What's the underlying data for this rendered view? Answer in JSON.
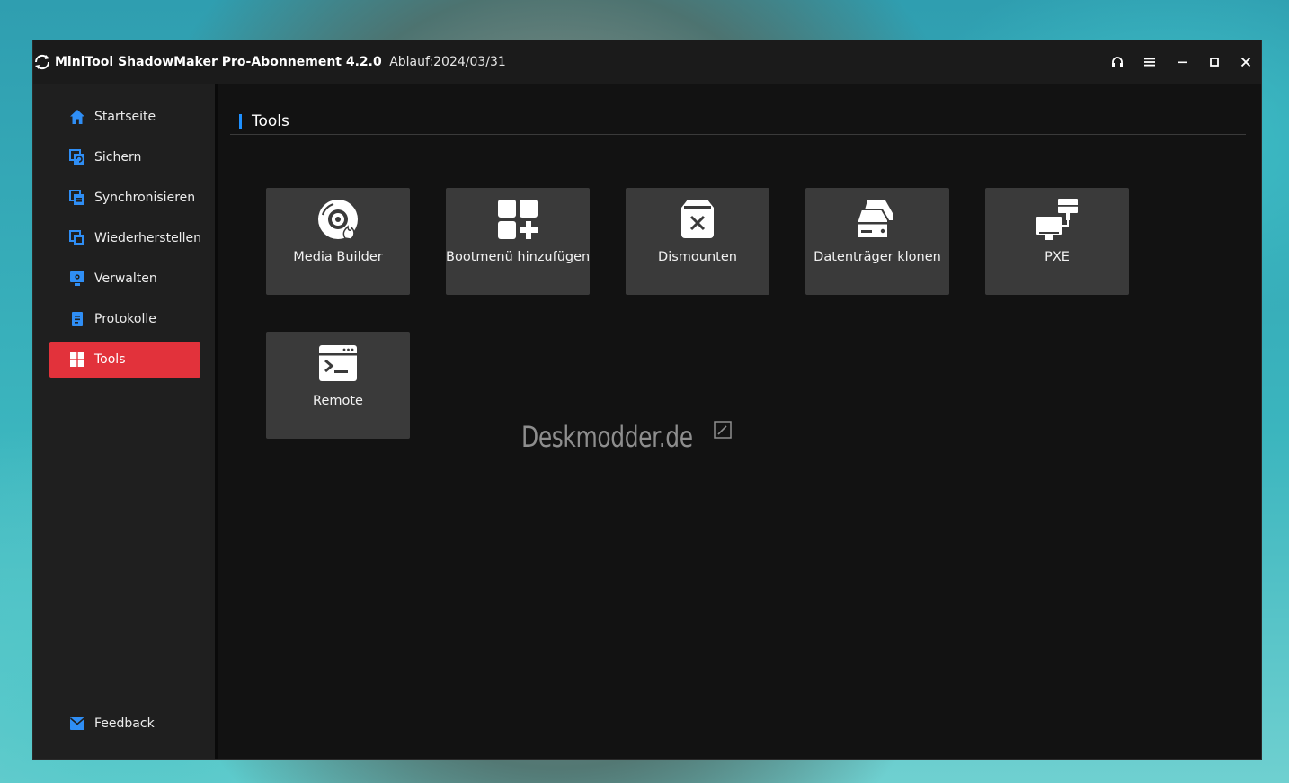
{
  "window": {
    "app_name": "MiniTool ShadowMaker Pro-Abonnement 4.2.0",
    "expiry": "Ablauf:2024/03/31"
  },
  "sidebar": {
    "items": [
      {
        "label": "Startseite",
        "icon": "home-icon"
      },
      {
        "label": "Sichern",
        "icon": "backup-icon"
      },
      {
        "label": "Synchronisieren",
        "icon": "sync-icon"
      },
      {
        "label": "Wiederherstellen",
        "icon": "restore-icon"
      },
      {
        "label": "Verwalten",
        "icon": "manage-icon"
      },
      {
        "label": "Protokolle",
        "icon": "logs-icon"
      },
      {
        "label": "Tools",
        "icon": "tools-icon",
        "active": true
      }
    ],
    "feedback": {
      "label": "Feedback",
      "icon": "mail-icon"
    }
  },
  "main": {
    "section_title": "Tools",
    "tools": [
      {
        "label": "Media Builder",
        "icon": "media-builder-icon"
      },
      {
        "label": "Bootmenü hinzufügen",
        "icon": "add-boot-menu-icon"
      },
      {
        "label": "Dismounten",
        "icon": "dismount-icon"
      },
      {
        "label": "Datenträger klonen",
        "icon": "clone-disk-icon"
      },
      {
        "label": "PXE",
        "icon": "pxe-icon"
      },
      {
        "label": "Remote",
        "icon": "remote-icon"
      }
    ]
  },
  "watermark": "Deskmodder.de",
  "colors": {
    "accent_active": "#e2323b",
    "icon_blue": "#2f8ef5",
    "section_accent": "#1e90ff",
    "tile_bg": "#3a3a3a",
    "window_bg": "#121212",
    "sidebar_bg": "#1f1f1f"
  }
}
